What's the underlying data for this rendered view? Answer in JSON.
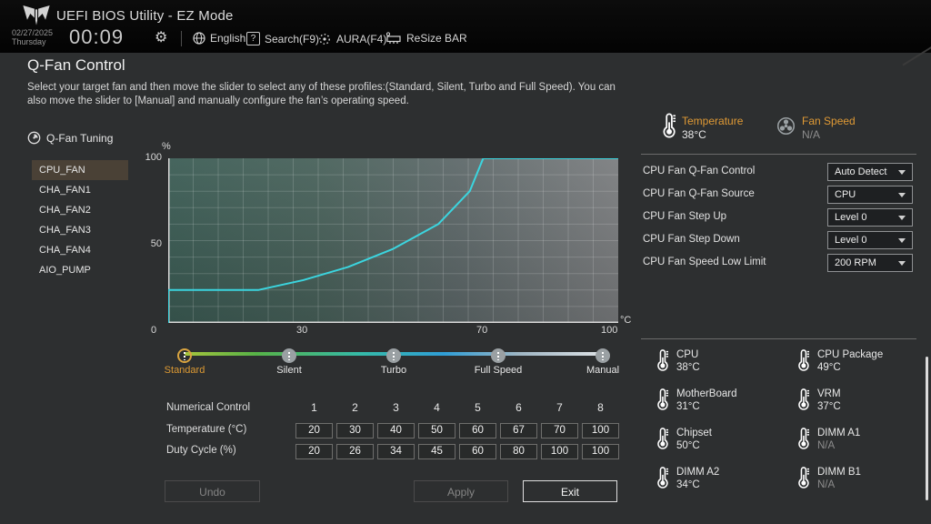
{
  "header": {
    "title": "UEFI BIOS Utility - EZ Mode",
    "date": "02/27/2025",
    "weekday": "Thursday",
    "time": "00:09",
    "icons": {
      "gear": "⚙",
      "search_glyph": "?"
    },
    "menu": {
      "language": "English",
      "search": "Search(F9)",
      "aura": "AURA(F4)",
      "resize_bar": "ReSize BAR"
    }
  },
  "page": {
    "title": "Q-Fan Control",
    "description": "Select your target fan and then move the slider to select any of these profiles:(Standard, Silent, Turbo and Full Speed). You can also move the slider to [Manual] and manually configure the fan’s operating speed."
  },
  "qfan": {
    "tuning_label": "Q-Fan Tuning",
    "fans": [
      "CPU_FAN",
      "CHA_FAN1",
      "CHA_FAN2",
      "CHA_FAN3",
      "CHA_FAN4",
      "AIO_PUMP"
    ],
    "selected_fan": "CPU_FAN"
  },
  "chart_data": {
    "type": "line",
    "title": "CPU_FAN duty cycle vs temperature",
    "xlabel": "°C",
    "ylabel": "%",
    "xlim": [
      0,
      100
    ],
    "ylim": [
      0,
      100
    ],
    "x": [
      0,
      20,
      30,
      40,
      50,
      60,
      67,
      70,
      100
    ],
    "y": [
      20,
      20,
      26,
      34,
      45,
      60,
      80,
      100,
      100
    ],
    "x_ticks": [
      0,
      30,
      70,
      100
    ],
    "y_ticks": [
      0,
      50,
      100
    ],
    "x_tick_labels": [
      "0",
      "30",
      "70",
      "100"
    ],
    "y_tick_labels_top_down": [
      "100",
      "50"
    ],
    "origin_label": "0",
    "grid": true,
    "legend": false,
    "line_color": "#3bd5df"
  },
  "slider": {
    "profiles": [
      "Standard",
      "Silent",
      "Turbo",
      "Full Speed",
      "Manual"
    ],
    "active_profile": "Standard"
  },
  "numerical_control": {
    "title": "Numerical Control",
    "columns": [
      "1",
      "2",
      "3",
      "4",
      "5",
      "6",
      "7",
      "8"
    ],
    "temperature_label": "Temperature (°C)",
    "temperature": [
      "20",
      "30",
      "40",
      "50",
      "60",
      "67",
      "70",
      "100"
    ],
    "duty_label": "Duty Cycle (%)",
    "duty_cycle": [
      "20",
      "26",
      "34",
      "45",
      "60",
      "80",
      "100",
      "100"
    ]
  },
  "buttons": {
    "undo": "Undo",
    "apply": "Apply",
    "exit": "Exit"
  },
  "status": {
    "temperature_label": "Temperature",
    "temperature_value": "38°C",
    "fan_speed_label": "Fan Speed",
    "fan_speed_value": "N/A"
  },
  "settings": [
    {
      "label": "CPU Fan Q-Fan Control",
      "value": "Auto Detect"
    },
    {
      "label": "CPU Fan Q-Fan Source",
      "value": "CPU"
    },
    {
      "label": "CPU Fan Step Up",
      "value": "Level 0"
    },
    {
      "label": "CPU Fan Step Down",
      "value": "Level 0"
    },
    {
      "label": "CPU Fan Speed Low Limit",
      "value": "200 RPM"
    }
  ],
  "sensors": [
    {
      "label": "CPU",
      "value": "38°C"
    },
    {
      "label": "CPU Package",
      "value": "49°C"
    },
    {
      "label": "MotherBoard",
      "value": "31°C"
    },
    {
      "label": "VRM",
      "value": "37°C"
    },
    {
      "label": "Chipset",
      "value": "50°C"
    },
    {
      "label": "DIMM A1",
      "value": "N/A"
    },
    {
      "label": "DIMM A2",
      "value": "34°C"
    },
    {
      "label": "DIMM B1",
      "value": "N/A"
    }
  ],
  "colors": {
    "accent_orange": "#e09a35",
    "curve_cyan": "#3bd5df",
    "selected_fan_bg": "#4a4136",
    "chart_teal_left": "#3c5d55",
    "chart_gray_right": "#7c7e80",
    "header_bg": "#050505",
    "body_bg": "#2d2f30"
  }
}
